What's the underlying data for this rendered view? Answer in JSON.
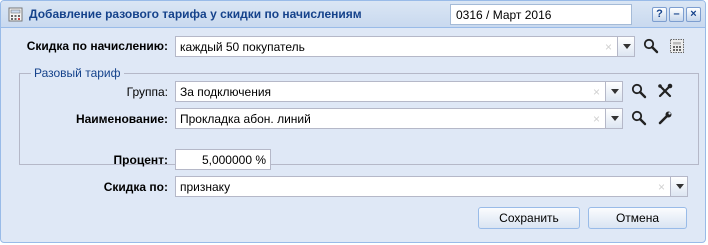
{
  "window": {
    "title": "Добавление разового тарифа у скидки по начислениям",
    "period": "0316 / Март 2016",
    "buttons": {
      "help": "?",
      "minimize": "–",
      "close": "×"
    }
  },
  "form": {
    "discount_label": "Скидка по начислению:",
    "discount_value": "каждый 50 покупатель",
    "fieldset_legend": "Разовый тариф",
    "group_label": "Группа:",
    "group_value": "За подключения",
    "name_label": "Наименование:",
    "name_value": "Прокладка абон. линий",
    "percent_label": "Процент:",
    "percent_value": "5,000000 %",
    "discount_by_label": "Скидка по:",
    "discount_by_value": "признаку",
    "clear_glyph": "×"
  },
  "actions": {
    "save_label": "Сохранить",
    "cancel_label": "Отмена"
  },
  "colors": {
    "title_text": "#15428b",
    "window_bg": "#dfe8f6",
    "border": "#99bbe8"
  }
}
